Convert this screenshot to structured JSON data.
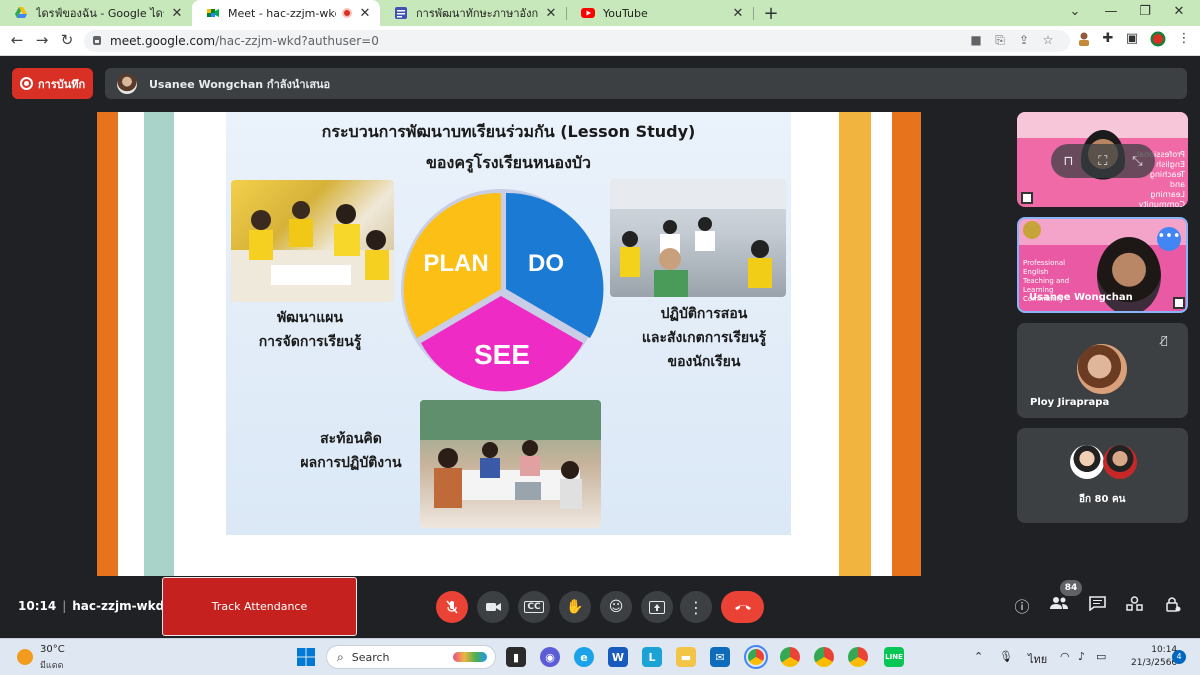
{
  "browser": {
    "tabs": [
      {
        "title": "ไดรฟ์ของฉัน - Google ไดรฟ์",
        "icon": "google-drive-icon",
        "active": false
      },
      {
        "title": "Meet - hac-zzjm-wkd",
        "icon": "google-meet-icon",
        "active": true,
        "recording": true
      },
      {
        "title": "การพัฒนาทักษะภาษาอังกฤษ English",
        "icon": "google-forms-icon",
        "active": false
      },
      {
        "title": "YouTube",
        "icon": "youtube-icon",
        "active": false
      }
    ],
    "url_host": "meet.google.com",
    "url_path": "/hac-zzjm-wkd?authuser=0"
  },
  "meet": {
    "record_label": "การบันทึก",
    "presenter_text": "Usanee Wongchan กำลังนำเสนอ",
    "slide": {
      "title_line1": "กระบวนการพัฒนาบทเรียนร่วมกัน (Lesson Study)",
      "title_line2": "ของครูโรงเรียนหนองบัว",
      "cycle": {
        "plan": "PLAN",
        "do": "DO",
        "see": "SEE"
      },
      "caption_plan": [
        "พัฒนาแผน",
        "การจัดการเรียนรู้"
      ],
      "caption_do": [
        "ปฏิบัติการสอน",
        "และสังเกตการเรียนรู้",
        "ของนักเรียน"
      ],
      "caption_see": [
        "สะท้อนคิด",
        "ผลการปฏิบัติงาน"
      ]
    },
    "tiles": [
      {
        "name": "",
        "tile_text": "Professional English Teaching and Learning Community"
      },
      {
        "name": "Usanee Wongchan",
        "tile_text": "Professional English Teaching and Learning Community"
      },
      {
        "name": "Ploy Jiraprapa"
      },
      {
        "name": "อีก 80 คน"
      }
    ],
    "meeting_time": "10:14",
    "meeting_code": "hac-zzjm-wkd",
    "attendance_label": "Track Attendance",
    "participants_count": "84",
    "colors": {
      "accent_red": "#ea4335",
      "pill_bg": "#3c4043",
      "tile_pink": "#e85aa8"
    }
  },
  "taskbar": {
    "weather_temp": "30°C",
    "weather_desc": "มีแดด",
    "search_placeholder": "Search",
    "language": "ไทย",
    "time": "10:14",
    "date": "21/3/2566",
    "notification_count": "4"
  }
}
